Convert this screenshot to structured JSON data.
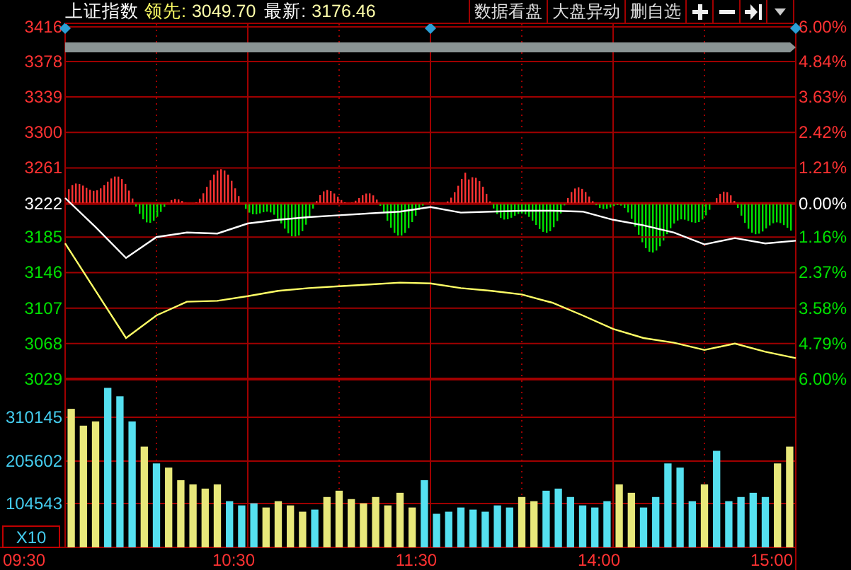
{
  "header": {
    "title": "上证指数",
    "lead_label": "领先:",
    "lead_value": "3049.70",
    "last_label": "最新:",
    "last_value": "3176.46",
    "buttons": [
      {
        "label": "数据看盘"
      },
      {
        "label": "大盘异动"
      },
      {
        "label": "删自选"
      }
    ],
    "icon_buttons": [
      {
        "kind": "plus"
      },
      {
        "kind": "minus"
      },
      {
        "kind": "jump-end"
      },
      {
        "kind": "dropdown"
      }
    ]
  },
  "price_panel": {
    "percent_labels": [
      "6.00%",
      "4.84%",
      "3.63%",
      "2.42%",
      "1.21%",
      "0.00%",
      "1.16%",
      "2.37%",
      "3.58%",
      "4.79%",
      "6.00%"
    ],
    "chart_data": {
      "type": "line",
      "grid": true,
      "ylim": [
        3029,
        3416
      ],
      "yticks": [
        {
          "value": 3416,
          "label": "3416"
        },
        {
          "value": 3378,
          "label": "3378"
        },
        {
          "value": 3339,
          "label": "3339"
        },
        {
          "value": 3300,
          "label": "3300"
        },
        {
          "value": 3261,
          "label": "3261"
        },
        {
          "value": 3222,
          "label": "3222"
        },
        {
          "value": 3185,
          "label": "3185"
        },
        {
          "value": 3146,
          "label": "3146"
        },
        {
          "value": 3107,
          "label": "3107"
        },
        {
          "value": 3068,
          "label": "3068"
        },
        {
          "value": 3029,
          "label": "3029"
        }
      ],
      "series": [
        {
          "color": "#ffffff",
          "values": [
            3228,
            3196,
            3162,
            3185,
            3190,
            3189,
            3200,
            3204,
            3207,
            3209,
            3211,
            3213,
            3218,
            3212,
            3213,
            3214,
            3214,
            3213,
            3204,
            3198,
            3190,
            3177,
            3184,
            3178,
            3181
          ]
        },
        {
          "color": "#ffff66",
          "values": [
            3178,
            3126,
            3074,
            3099,
            3114,
            3115,
            3120,
            3126,
            3129,
            3131,
            3133,
            3135,
            3134,
            3129,
            3126,
            3122,
            3113,
            3099,
            3084,
            3074,
            3069,
            3061,
            3068,
            3059,
            3052
          ]
        }
      ]
    }
  },
  "volume_panel": {
    "unit_label": "X10",
    "chart_data": {
      "type": "bar",
      "grid": true,
      "ylim": [
        0,
        401000
      ],
      "yticks": [
        {
          "value": 310145,
          "label": "310145"
        },
        {
          "value": 205602,
          "label": "205602"
        },
        {
          "value": 104543,
          "label": "104543"
        }
      ],
      "series": [
        {
          "color": "#e8e87a",
          "values": [
            330000,
            290000,
            300000,
            null,
            null,
            null,
            240000,
            null,
            190000,
            160000,
            150000,
            140000,
            150000,
            null,
            null,
            null,
            95000,
            110000,
            100000,
            85000,
            null,
            120000,
            135000,
            115000,
            105000,
            120000,
            100000,
            130000,
            95000,
            null,
            null,
            null,
            null,
            null,
            null,
            null,
            null,
            120000,
            110000,
            null,
            null,
            null,
            null,
            null,
            null,
            150000,
            130000,
            null,
            null,
            null,
            null,
            null,
            150000,
            null,
            null,
            null,
            null,
            null,
            200000,
            240000
          ]
        },
        {
          "color": "#55e0f0",
          "values": [
            null,
            null,
            null,
            380000,
            360000,
            300000,
            null,
            200000,
            null,
            null,
            null,
            null,
            null,
            110000,
            100000,
            105000,
            null,
            null,
            null,
            null,
            90000,
            null,
            null,
            null,
            null,
            null,
            null,
            null,
            null,
            160000,
            80000,
            85000,
            95000,
            90000,
            85000,
            100000,
            95000,
            null,
            null,
            135000,
            140000,
            120000,
            100000,
            95000,
            110000,
            null,
            null,
            95000,
            120000,
            200000,
            190000,
            110000,
            null,
            230000,
            110000,
            120000,
            130000,
            120000,
            null,
            null
          ]
        }
      ]
    }
  },
  "time_labels": [
    "09:30",
    "10:30",
    "11:30",
    "14:00",
    "15:00"
  ]
}
